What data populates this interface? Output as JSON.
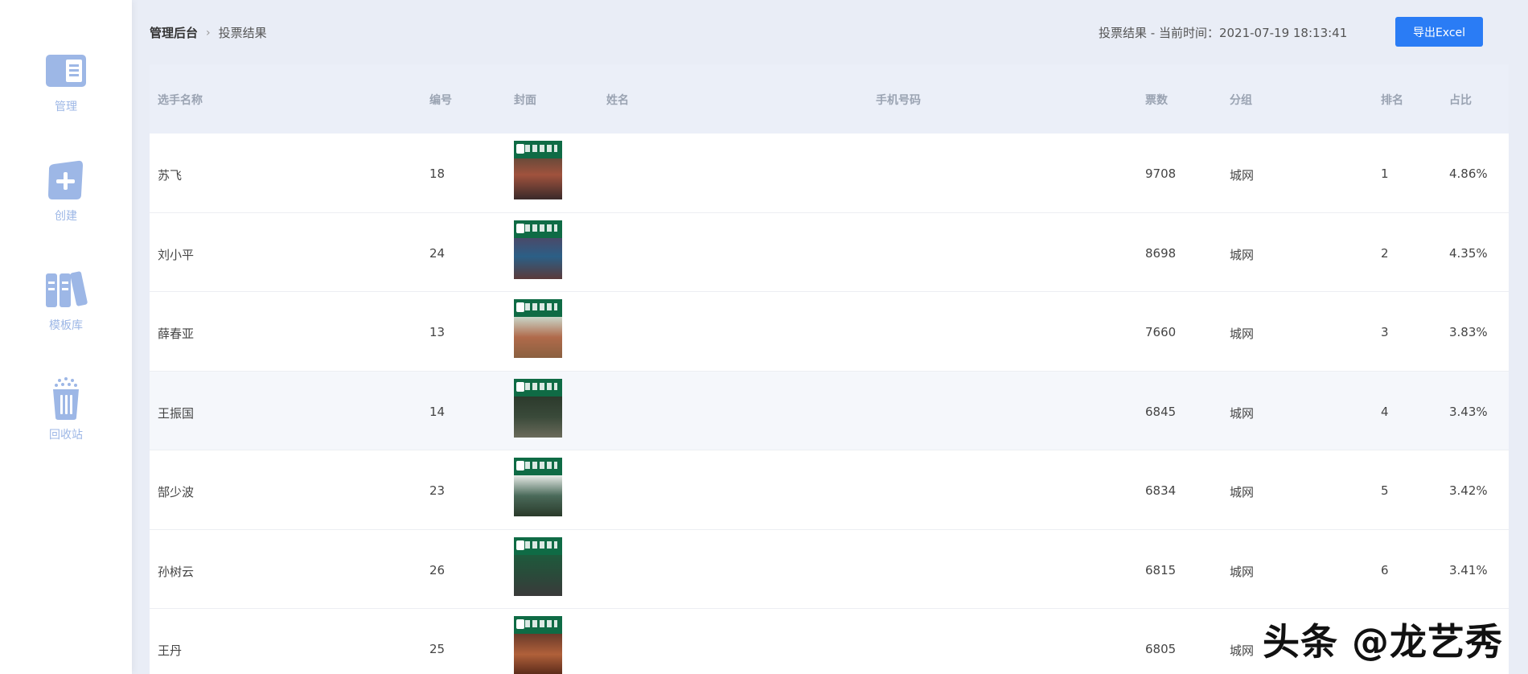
{
  "sidebar": {
    "items": [
      {
        "label": "管理",
        "icon": "manage-icon"
      },
      {
        "label": "创建",
        "icon": "create-icon"
      },
      {
        "label": "模板库",
        "icon": "template-library-icon"
      },
      {
        "label": "回收站",
        "icon": "recycle-bin-icon"
      }
    ]
  },
  "header": {
    "breadcrumb_root": "管理后台",
    "breadcrumb_current": "投票结果",
    "timestamp": "投票结果 - 当前时间：2021-07-19 18:13:41",
    "export_label": "导出Excel"
  },
  "table": {
    "columns": [
      "选手名称",
      "编号",
      "封面",
      "姓名",
      "手机号码",
      "票数",
      "分组",
      "排名",
      "占比"
    ],
    "rows": [
      {
        "name": "苏飞",
        "id": "18",
        "votes": "9708",
        "group": "城网",
        "rank": "1",
        "ratio": "4.86%"
      },
      {
        "name": "刘小平",
        "id": "24",
        "votes": "8698",
        "group": "城网",
        "rank": "2",
        "ratio": "4.35%"
      },
      {
        "name": "薛春亚",
        "id": "13",
        "votes": "7660",
        "group": "城网",
        "rank": "3",
        "ratio": "3.83%"
      },
      {
        "name": "王振国",
        "id": "14",
        "votes": "6845",
        "group": "城网",
        "rank": "4",
        "ratio": "3.43%"
      },
      {
        "name": "郜少波",
        "id": "23",
        "votes": "6834",
        "group": "城网",
        "rank": "5",
        "ratio": "3.42%"
      },
      {
        "name": "孙树云",
        "id": "26",
        "votes": "6815",
        "group": "城网",
        "rank": "6",
        "ratio": "3.41%"
      },
      {
        "name": "王丹",
        "id": "25",
        "votes": "6805",
        "group": "城网",
        "rank": "",
        "ratio": ""
      }
    ]
  },
  "watermark": "头条 @龙艺秀",
  "colors": {
    "accent": "#2a7cf5",
    "sidebar_icon": "#9db7e6",
    "page_bg": "#e9edf6"
  }
}
